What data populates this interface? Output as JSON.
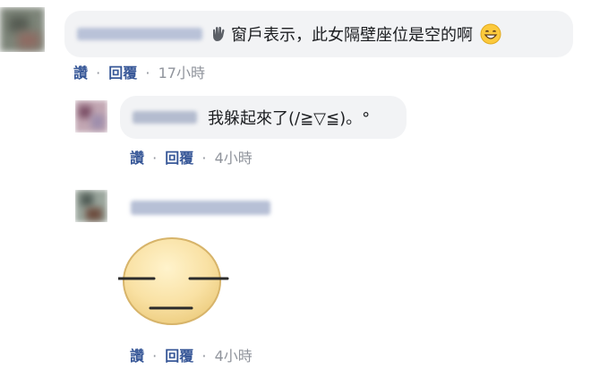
{
  "comments": [
    {
      "icon": "waving-hand-icon",
      "text": "窗戶表示，此女隔壁座位是空的啊",
      "emoji": "grinning-face-icon",
      "actions": {
        "like": "讚",
        "sep1": "·",
        "reply": "回覆",
        "sep2": "·",
        "time": "17小時"
      }
    },
    {
      "text": "我躲起來了(/≧▽≦)。°",
      "actions": {
        "like": "讚",
        "sep1": "·",
        "reply": "回覆",
        "sep2": "·",
        "time": "4小時"
      }
    },
    {
      "sticker": "expressionless-face-sticker",
      "actions": {
        "like": "讚",
        "sep1": "·",
        "reply": "回覆",
        "sep2": "·",
        "time": "4小時"
      }
    }
  ],
  "colors": {
    "link": "#385898",
    "meta": "#90949c",
    "bubble": "#f2f3f5",
    "sticker_face": "#f7dfa1"
  }
}
